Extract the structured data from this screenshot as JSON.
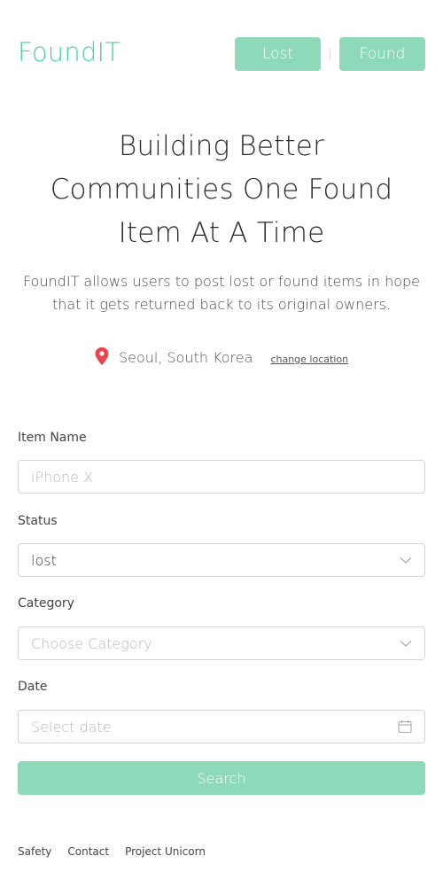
{
  "header": {
    "logo": "FoundIT",
    "nav": {
      "lost_label": "Lost",
      "found_label": "Found"
    }
  },
  "hero": {
    "title_line1": "Building Better",
    "title_line2": "Communities One Found",
    "title_line3": "Item At A Time",
    "description": "FoundIT allows users to post lost or found items in hope that it gets returned back to its original owners."
  },
  "location": {
    "name": "Seoul, South Korea",
    "change_label": "change location",
    "pin_color": "#e8484d"
  },
  "form": {
    "item_name": {
      "label": "Item Name",
      "placeholder": "iPhone X",
      "value": ""
    },
    "status": {
      "label": "Status",
      "value": "lost"
    },
    "category": {
      "label": "Category",
      "placeholder": "Choose Category"
    },
    "date": {
      "label": "Date",
      "placeholder": "Select date"
    },
    "search_label": "Search"
  },
  "footer": {
    "links": [
      "Safety",
      "Contact",
      "Project Unicorn"
    ]
  },
  "colors": {
    "brand": "#4fd0a4",
    "button": "#8fd9bb"
  },
  "icons": {
    "pin": "map-pin-icon",
    "dropdown": "chevron-down-icon",
    "date": "calendar-icon"
  }
}
